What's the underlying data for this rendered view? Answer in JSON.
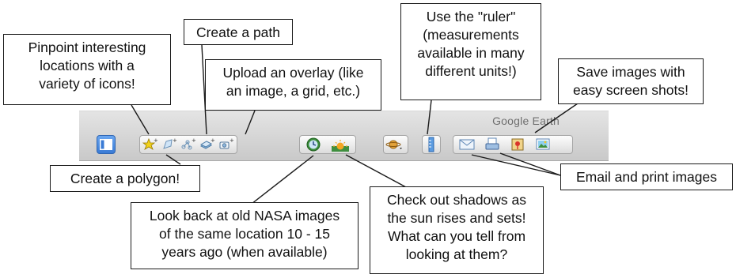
{
  "app": {
    "title": "Google Earth"
  },
  "toolbar": {
    "buttons": [
      {
        "name": "sidebar-toggle",
        "icon": "sidebar-icon"
      },
      {
        "name": "add-placemark",
        "icon": "pushpin-add-icon"
      },
      {
        "name": "add-polygon",
        "icon": "polygon-add-icon"
      },
      {
        "name": "add-path",
        "icon": "path-add-icon"
      },
      {
        "name": "add-image-overlay",
        "icon": "overlay-add-icon"
      },
      {
        "name": "record-tour",
        "icon": "camera-add-icon"
      },
      {
        "name": "historical-imagery",
        "icon": "clock-globe-icon"
      },
      {
        "name": "sunlight",
        "icon": "sunrise-icon"
      },
      {
        "name": "switch-planet",
        "icon": "planet-icon"
      },
      {
        "name": "ruler",
        "icon": "ruler-icon"
      },
      {
        "name": "email",
        "icon": "envelope-icon"
      },
      {
        "name": "print",
        "icon": "printer-icon"
      },
      {
        "name": "view-in-google-maps",
        "icon": "map-icon"
      },
      {
        "name": "save-image",
        "icon": "image-icon"
      }
    ]
  },
  "callouts": {
    "pinpoint": [
      "Pinpoint interesting",
      "locations with a",
      "variety of icons!"
    ],
    "path": [
      "Create a path"
    ],
    "overlay": [
      "Upload an overlay (like",
      "an image, a grid, etc.)"
    ],
    "ruler": [
      "Use the \"ruler\"",
      "(measurements",
      "available in many",
      "different units!)"
    ],
    "save": [
      "Save images with",
      "easy screen shots!"
    ],
    "polygon": [
      "Create a polygon!"
    ],
    "nasa": [
      "Look back at old NASA images",
      "of the same location 10 - 15",
      "years ago (when available)"
    ],
    "shadows": [
      "Check out shadows as",
      "the sun rises and sets!",
      "What can you tell from",
      "looking at them?"
    ],
    "email_print": [
      "Email and print images"
    ]
  },
  "colors": {
    "accent": "#3a7bd5",
    "toolbar_bg": "#d6d6d6",
    "line": "#1a1a1a"
  }
}
